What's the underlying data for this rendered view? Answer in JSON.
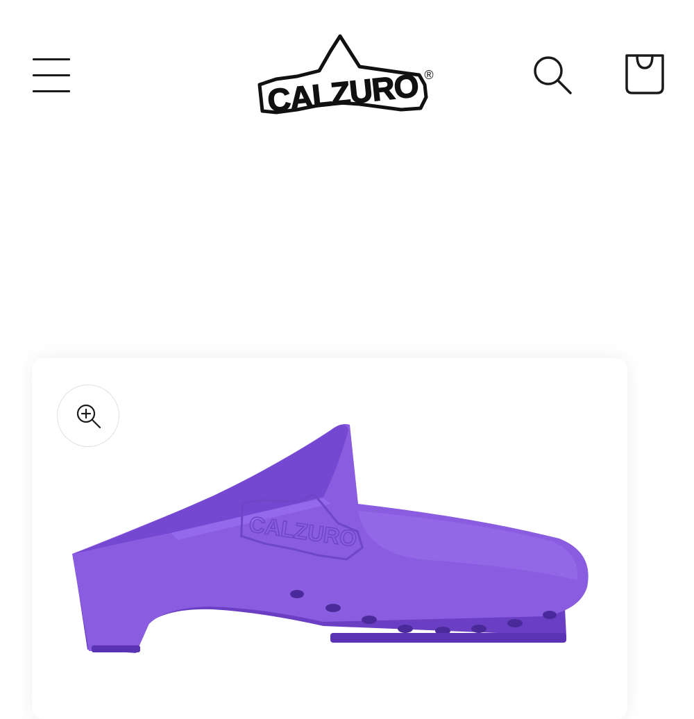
{
  "header": {
    "menu_icon": "hamburger-menu-icon",
    "logo": {
      "text": "CALZURO",
      "mark": "®"
    },
    "search_icon": "search-icon",
    "cart_icon": "shopping-bag-icon"
  },
  "gallery": {
    "zoom_icon": "zoom-in-icon",
    "product_color": "#8a5ce0",
    "embossed_logo": "CALZURO"
  },
  "colors": {
    "product_purple": "#8a5ce0",
    "product_dark": "#6a3fc4",
    "icon": "#1a1a1a"
  }
}
